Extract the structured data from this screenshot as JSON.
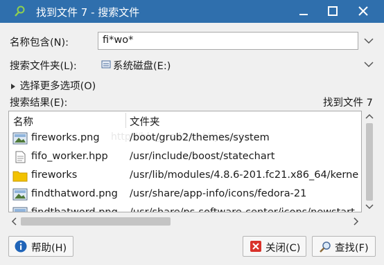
{
  "window": {
    "title": "找到文件 7 - 搜索文件"
  },
  "form": {
    "name_label": "名称包含(N):",
    "name_value": "fi*wo*",
    "folder_label": "搜索文件夹(L):",
    "folder_value": "系统磁盘(E:)",
    "more_options": "选择更多选项(O)",
    "results_label": "搜索结果(E):",
    "found_count": "找到文件 7"
  },
  "table": {
    "columns": [
      "名称",
      "文件夹"
    ],
    "rows": [
      {
        "name": "fireworks.png",
        "path": "/boot/grub2/themes/system",
        "icon": "image-file-icon"
      },
      {
        "name": "fifo_worker.hpp",
        "path": "/usr/include/boost/statechart",
        "icon": "text-file-icon"
      },
      {
        "name": "fireworks",
        "path": "/usr/lib/modules/4.8.6-201.fc21.x86_64/kerne",
        "icon": "folder-icon"
      },
      {
        "name": "findthatword.png",
        "path": "/usr/share/app-info/icons/fedora-21",
        "icon": "image-file-icon"
      },
      {
        "name": "findthatword.png",
        "path": "/usr/share/ps-software-center/icons/newstart",
        "icon": "image-file-icon"
      }
    ]
  },
  "watermark": "http://blog.csdn.net/cjacarey",
  "buttons": {
    "help": "帮助(H)",
    "close": "关闭(C)",
    "find": "查找(F)"
  },
  "colors": {
    "titlebar": "#2f6fad",
    "folder": "#f2c200",
    "close_icon": "#d9322b",
    "help_icon": "#1f64b8"
  }
}
